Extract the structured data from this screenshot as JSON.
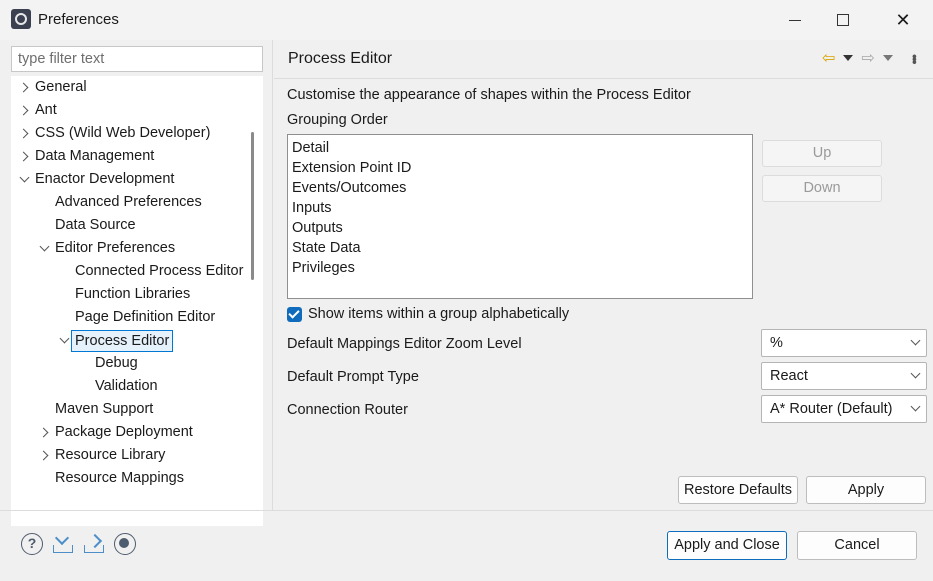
{
  "window": {
    "title": "Preferences",
    "minimize_icon": "minimize-icon",
    "maximize_icon": "maximize-icon",
    "close_icon": "close-icon"
  },
  "filter": {
    "placeholder": "type filter text",
    "value": ""
  },
  "tree": {
    "items": [
      {
        "label": "General",
        "level": 0,
        "expander": "collapsed"
      },
      {
        "label": "Ant",
        "level": 0,
        "expander": "collapsed"
      },
      {
        "label": "CSS (Wild Web Developer)",
        "level": 0,
        "expander": "collapsed"
      },
      {
        "label": "Data Management",
        "level": 0,
        "expander": "collapsed"
      },
      {
        "label": "Enactor Development",
        "level": 0,
        "expander": "expanded"
      },
      {
        "label": "Advanced Preferences",
        "level": 1,
        "expander": "none"
      },
      {
        "label": "Data Source",
        "level": 1,
        "expander": "none"
      },
      {
        "label": "Editor Preferences",
        "level": 1,
        "expander": "expanded"
      },
      {
        "label": "Connected Process Editor",
        "level": 2,
        "expander": "none"
      },
      {
        "label": "Function Libraries",
        "level": 2,
        "expander": "none"
      },
      {
        "label": "Page Definition Editor",
        "level": 2,
        "expander": "none"
      },
      {
        "label": "Process Editor",
        "level": 2,
        "expander": "expanded",
        "selected": true
      },
      {
        "label": "Debug",
        "level": 3,
        "expander": "none"
      },
      {
        "label": "Validation",
        "level": 3,
        "expander": "none"
      },
      {
        "label": "Maven Support",
        "level": 1,
        "expander": "none"
      },
      {
        "label": "Package Deployment",
        "level": 1,
        "expander": "collapsed"
      },
      {
        "label": "Resource Library",
        "level": 1,
        "expander": "collapsed"
      },
      {
        "label": "Resource Mappings",
        "level": 1,
        "expander": "none"
      }
    ]
  },
  "page": {
    "title": "Process Editor",
    "nav": {
      "back_icon": "back-arrow-icon",
      "forward_icon": "forward-arrow-icon",
      "menu_icon": "view-menu-icon"
    },
    "description": "Customise the appearance of shapes within the Process Editor",
    "grouping_label": "Grouping Order",
    "grouping_items": [
      "Detail",
      "Extension Point ID",
      "Events/Outcomes",
      "Inputs",
      "Outputs",
      "State Data",
      "Privileges"
    ],
    "up_label": "Up",
    "down_label": "Down",
    "alphabetical": {
      "label": "Show items within a group alphabetically",
      "checked": true
    },
    "zoom": {
      "label": "Default Mappings Editor Zoom Level",
      "value": "%"
    },
    "prompt": {
      "label": "Default Prompt Type",
      "value": "React"
    },
    "router": {
      "label": "Connection Router",
      "value": "A* Router (Default)"
    },
    "restore_label": "Restore Defaults",
    "apply_label": "Apply"
  },
  "footer": {
    "help_icon": "help-icon",
    "import_icon": "import-icon",
    "export_icon": "export-icon",
    "record_icon": "record-icon",
    "help_glyph": "?",
    "apply_close_label": "Apply and Close",
    "cancel_label": "Cancel"
  },
  "colors": {
    "accent": "#0f6cbd",
    "selection_bg": "#e5f1fb",
    "back_arrow": "#d9a400"
  }
}
